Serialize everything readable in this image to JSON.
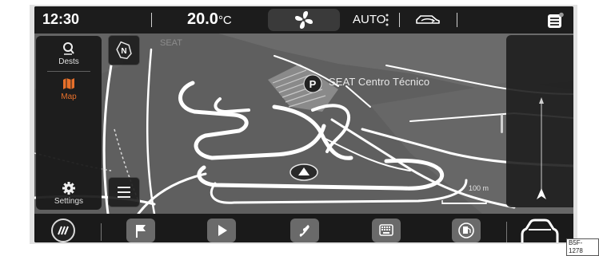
{
  "status_bar": {
    "time": "12:30",
    "temperature": "20.0",
    "temperature_unit": "°C",
    "climate_mode": "AUTO"
  },
  "sidebar": {
    "items": [
      {
        "label": "Dests",
        "icon": "destinations-icon"
      },
      {
        "label": "Map",
        "icon": "map-icon",
        "active": true
      },
      {
        "label": "Settings",
        "icon": "gear-icon"
      }
    ]
  },
  "map": {
    "compass": "N",
    "area_label": "SEAT",
    "poi_marker": "P",
    "poi_label": "SEAT Centro Técnico",
    "scale_label": "100 m"
  },
  "dock": {
    "items": [
      "climate-icon",
      "flag-icon",
      "play-icon",
      "phone-icon",
      "keyboard-icon",
      "fuel-icon",
      "car-icon"
    ],
    "page": 1,
    "page_count": 2
  },
  "colors": {
    "accent": "#e8702a",
    "map_background": "#5f5f5f",
    "road": "#ffffff",
    "screen_bg": "#1b1b1b"
  },
  "image_code": "B5F-1278"
}
